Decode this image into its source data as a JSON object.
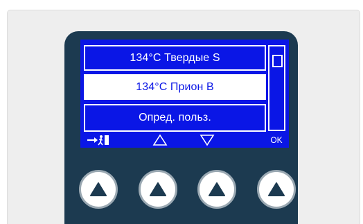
{
  "menu": {
    "items": [
      {
        "label": "134°C Твердые S",
        "selected": false
      },
      {
        "label": "134°C Прион B",
        "selected": true
      },
      {
        "label": "Опред. польз.",
        "selected": false
      }
    ]
  },
  "softkeys": {
    "exit_icon": "exit-door-icon",
    "up_icon": "triangle-up-outline-icon",
    "down_icon": "triangle-down-outline-icon",
    "ok_label": "OK"
  },
  "hardware_buttons": [
    {
      "icon": "triangle-up-icon"
    },
    {
      "icon": "triangle-up-icon"
    },
    {
      "icon": "triangle-up-icon"
    },
    {
      "icon": "triangle-up-icon"
    }
  ],
  "colors": {
    "screen_blue": "#0a16e6",
    "device_body": "#1c3a50",
    "selected_bg": "#ffffff"
  }
}
